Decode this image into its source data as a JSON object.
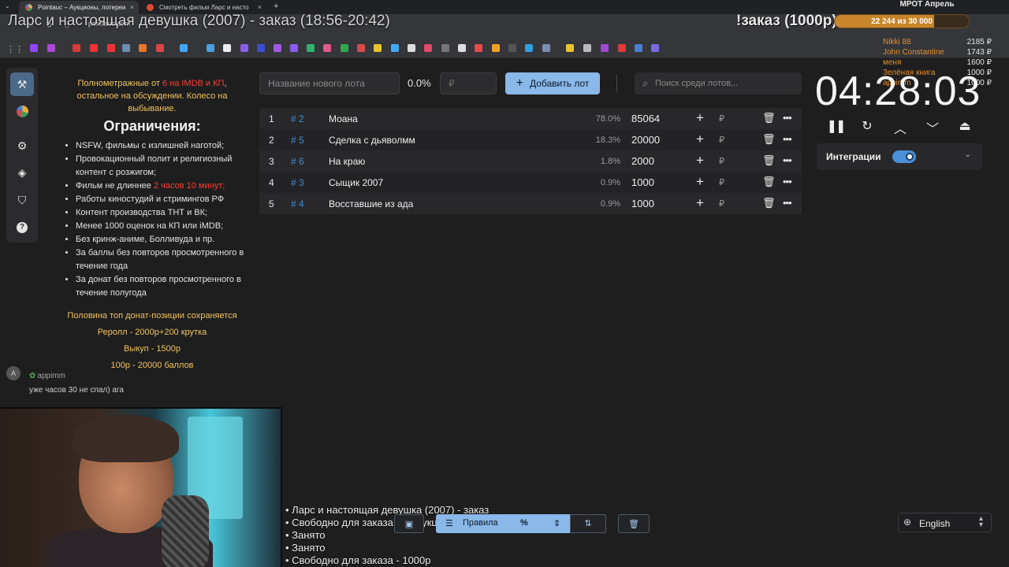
{
  "browser": {
    "tabs": [
      {
        "label": "Pointauc – Аукционы, лотереи"
      },
      {
        "label": "Смотреть фильм Ларс и насто"
      }
    ],
    "url": "pointauc.com"
  },
  "overlay": {
    "title": "Ларс и настоящая девушка (2007) - заказ (18:56-20:42)",
    "order_tag": "!заказ (1000р)",
    "mrot": {
      "title": "МРОТ Апрель",
      "current": "22 244",
      "separator": "из",
      "target": "30 000",
      "progress": 0.741
    },
    "top_donors": [
      {
        "name": "Nikki 88",
        "amount": "2185 ₽"
      },
      {
        "name": "John Constantine",
        "amount": "1743 ₽"
      },
      {
        "name": "меня",
        "amount": "1600 ₽"
      },
      {
        "name": "Зелёная книга",
        "amount": "1000 ₽"
      },
      {
        "name": "appimm",
        "amount": "1000 ₽"
      }
    ]
  },
  "sidebar": {
    "items": [
      {
        "icon": "gavel-icon",
        "active": true
      },
      {
        "icon": "pie-chart-icon",
        "active": false
      },
      {
        "icon": "gear-icon",
        "active": false
      },
      {
        "icon": "layers-icon",
        "active": false
      },
      {
        "icon": "shield-icon",
        "active": false
      },
      {
        "icon": "help-icon",
        "active": false
      }
    ]
  },
  "rules": {
    "intro_prefix": "Полнометражные от ",
    "intro_red": "6 на IMDB и КП",
    "intro_suffix": ", остальное на обсуждении. Колесо на выбывание.",
    "heading": "Ограничения:",
    "items": [
      {
        "text": "NSFW, фильмы с излишней наготой;"
      },
      {
        "text": "Провокационный полит и религиозный контент с розжигом;"
      },
      {
        "text": "Фильм не длиннее ",
        "red": "2 часов 10 минут;"
      },
      {
        "text": "Работы киностудий и стримингов РФ"
      },
      {
        "text": "Контент производства ТНТ и ВК;"
      },
      {
        "text": "Менее 1000 оценок на КП или iMDB;"
      },
      {
        "text": "Без кринж-аниме, Болливуда и пр."
      },
      {
        "text": "За баллы без повторов просмотренного в течение года"
      },
      {
        "text": "За донат без повторов просмотренного в течение полугода"
      }
    ],
    "footer": [
      "Половина топ донат-позиции сохраняется",
      "Реролл - 2000р+200 крутка",
      "Выкуп - 1500р",
      "100р - 20000 баллов"
    ]
  },
  "chat": {
    "avatar_letter": "A",
    "username": "appimm",
    "message": "уже часов 30 не спал) ага"
  },
  "controls": {
    "lot_name_placeholder": "Название нового лота",
    "percent": "0.0%",
    "amount_placeholder": "₽",
    "add_button": "Добавить лот",
    "search_placeholder": "Поиск среди лотов..."
  },
  "lots": [
    {
      "index": "1",
      "id": "# 2",
      "title": "Моана",
      "percent": "78.0%",
      "amount": "85064"
    },
    {
      "index": "2",
      "id": "# 5",
      "title": "Сделка с дьяволмм",
      "percent": "18.3%",
      "amount": "20000"
    },
    {
      "index": "3",
      "id": "# 6",
      "title": "На краю",
      "percent": "1.8%",
      "amount": "2000"
    },
    {
      "index": "4",
      "id": "# 3",
      "title": "Сыщик 2007",
      "percent": "0.9%",
      "amount": "1000"
    },
    {
      "index": "5",
      "id": "# 4",
      "title": "Восставшие из ада",
      "percent": "0.9%",
      "amount": "1000"
    }
  ],
  "lot_row": {
    "plus": "+",
    "currency": "₽",
    "trash": "🗑",
    "more": "•••"
  },
  "timer": {
    "value": "04:28:03",
    "controls": [
      "pause-icon",
      "restart-icon",
      "chevron-up-icon",
      "chevron-down-icon",
      "eject-icon"
    ]
  },
  "integrations": {
    "label": "Интеграции",
    "enabled": true
  },
  "order_list": [
    "• Ларс и настоящая девушка (2007) - заказ",
    "• Свободно для заказа или аукциона",
    "• Занято",
    "• Занято",
    "• Свободно для заказа - 1000р"
  ],
  "bottom_toolbar": {
    "rules_label": "Правила",
    "percent_label": "%"
  },
  "language": {
    "value": "English"
  },
  "colors": {
    "accent": "#8ab8e8",
    "lot_id": "#3d8ed6",
    "rules_highlight": "#f1c35a",
    "rules_red": "#ff3b30",
    "donor_name": "#e58e26",
    "mrot_fill": "#c9852a"
  }
}
